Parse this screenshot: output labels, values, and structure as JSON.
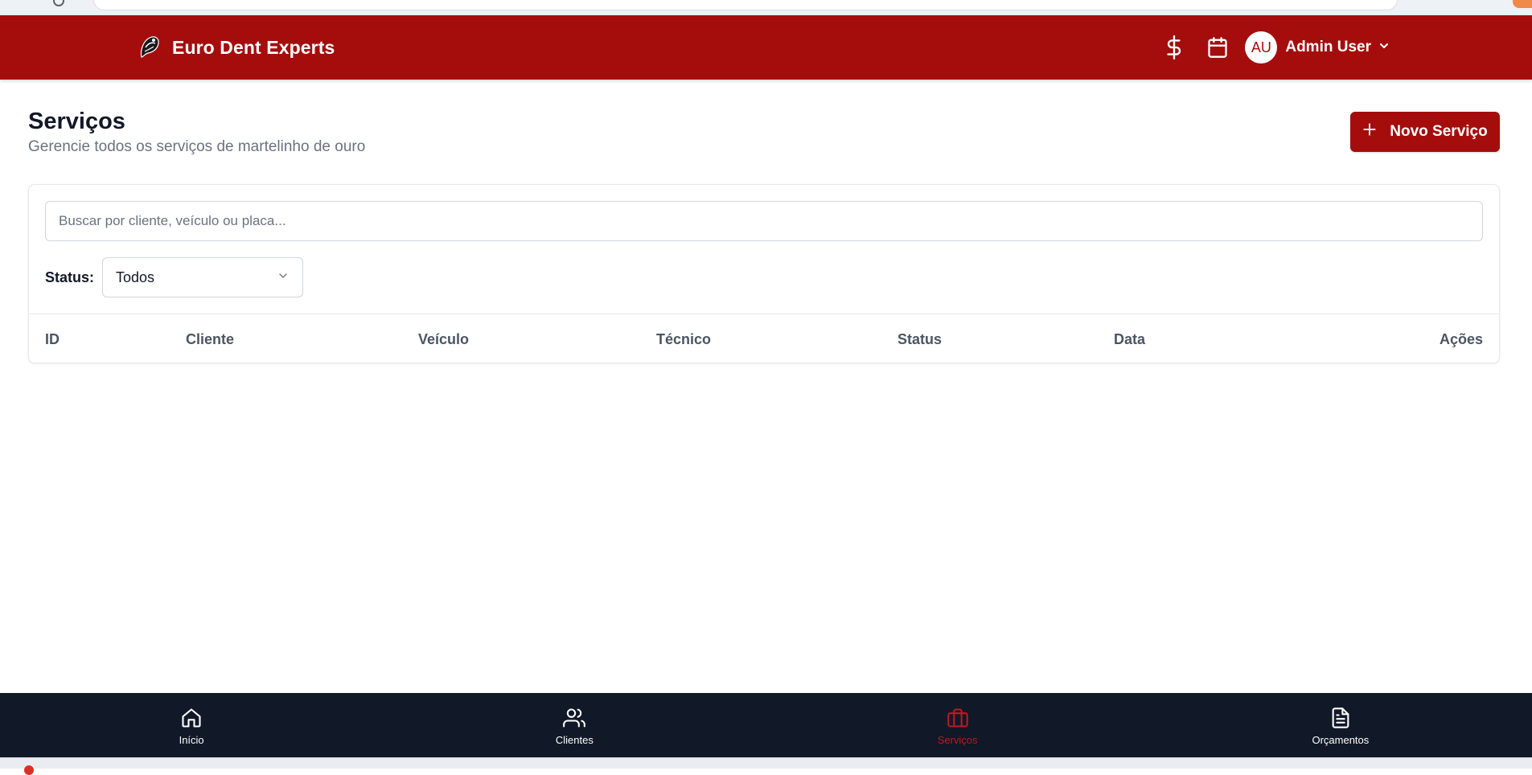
{
  "header": {
    "brand_name": "Euro Dent Experts",
    "icons": [
      "dollar-icon",
      "calendar-icon"
    ],
    "user": {
      "initials": "AU",
      "name": "Admin User"
    }
  },
  "page": {
    "title": "Serviços",
    "subtitle": "Gerencie todos os serviços de martelinho de ouro",
    "new_button_label": "Novo Serviço"
  },
  "filters": {
    "search_placeholder": "Buscar por cliente, veículo ou placa...",
    "search_value": "",
    "status_label": "Status:",
    "status_selected": "Todos"
  },
  "table": {
    "columns": [
      "ID",
      "Cliente",
      "Veículo",
      "Técnico",
      "Status",
      "Data",
      "Ações"
    ],
    "rows": []
  },
  "bottom_nav": {
    "items": [
      {
        "label": "Início",
        "icon": "home-icon"
      },
      {
        "label": "Clientes",
        "icon": "users-icon"
      },
      {
        "label": "Serviços",
        "icon": "briefcase-icon",
        "active": true
      },
      {
        "label": "Orçamentos",
        "icon": "document-icon"
      }
    ]
  },
  "colors": {
    "brand": "#a50d0d",
    "nav_background": "#111827",
    "active_nav": "#b91c1c"
  }
}
